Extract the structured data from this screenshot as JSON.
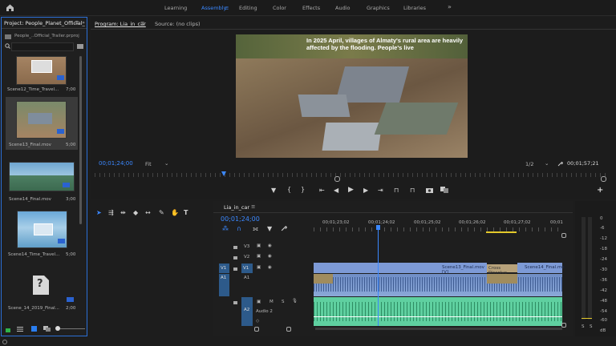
{
  "workspaces": [
    "Learning",
    "Assembly",
    "Editing",
    "Color",
    "Effects",
    "Audio",
    "Graphics",
    "Libraries"
  ],
  "workspaces_more": "»",
  "project": {
    "tab": "Project: People_Planet_Official_",
    "menu_icon": "≡",
    "more": "»",
    "file": "People_..Official_Trailer.prproj",
    "items": [
      {
        "name": "Scene12_Time_Travel...",
        "dur": "7;00"
      },
      {
        "name": "Scene13_Final.mov",
        "dur": "5;00"
      },
      {
        "name": "Scene14_Final.mov",
        "dur": "3;00"
      },
      {
        "name": "Scene14_Time_Travel...",
        "dur": "5;00"
      },
      {
        "name": "Scene_14_2019_Final...",
        "dur": "2;00"
      }
    ]
  },
  "program": {
    "tab": "Program: Lia_in_car",
    "menu_icon": "≡",
    "source_tab": "Source: (no clips)",
    "caption": "In 2025 April, villages of Almaty's rural area are heavily affected by the flooding. People's live",
    "timecode": "00;01;24;00",
    "fit": "Fit",
    "resolution": "1/2",
    "duration": "00;01;57;21",
    "plus": "+"
  },
  "timeline": {
    "tab": "Lia_in_car",
    "menu_icon": "≡",
    "timecode": "00;01;24;00",
    "ruler": [
      "00;01;23;02",
      "00;01;24;02",
      "00;01;25;02",
      "00;01;26;02",
      "00;01;27;02",
      "00;01"
    ],
    "tracks": {
      "v3": "V3",
      "v2": "V2",
      "v1": "V1",
      "v1src": "V1",
      "a1": "A1",
      "a1src": "A1",
      "a2": "A2",
      "audio2": "Audio 2"
    },
    "clips": {
      "scene13": "Scene13_Final.mov [V]",
      "transition": "Cross Dissolve",
      "scene14": "Scene14_Final.mo"
    },
    "track_btns": {
      "m": "M",
      "s": "S"
    }
  },
  "meters": {
    "scale": [
      "0",
      "-6",
      "-12",
      "-18",
      "-24",
      "-30",
      "-36",
      "-42",
      "-48",
      "-54",
      "-60"
    ],
    "db_bottom": "dB",
    "solo": [
      "S",
      "S"
    ]
  },
  "colors": {
    "accent": "#3b88ff",
    "video_clip": "#7d9ad6",
    "audio_clip": "#5fd0a0",
    "track_blue": "#2d5a8a",
    "playhead": "#3b88ff"
  }
}
